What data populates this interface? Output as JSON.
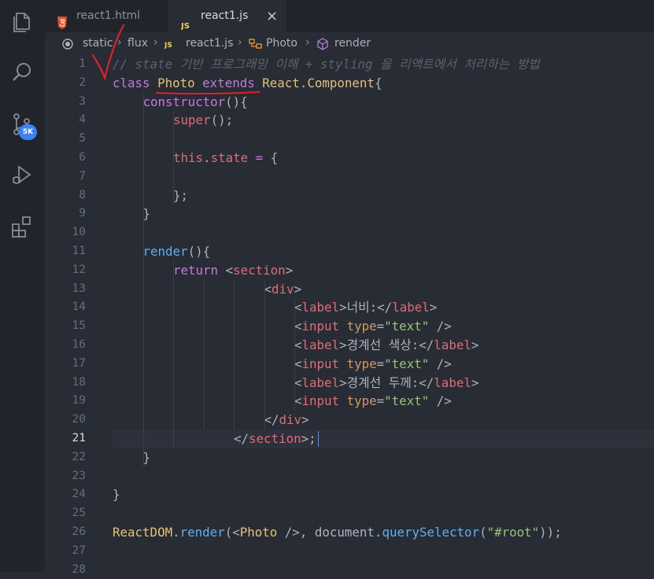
{
  "tabs": [
    {
      "label": "react1.html",
      "icon": "html5-icon",
      "active": false
    },
    {
      "label": "react1.js",
      "icon": "js-icon",
      "active": true
    }
  ],
  "tab_close": "×",
  "breadcrumb": [
    "static",
    "flux",
    "react1.js",
    "Photo",
    "render"
  ],
  "scm_badge": "5K",
  "colors": {
    "accent": "#3b82f6",
    "annotation": "#e0202a",
    "editor_bg": "#282c34"
  },
  "editor": {
    "active_line": 21,
    "line_numbers": [
      "1",
      "2",
      "3",
      "4",
      "5",
      "6",
      "7",
      "8",
      "9",
      "10",
      "11",
      "12",
      "13",
      "14",
      "15",
      "16",
      "17",
      "18",
      "19",
      "20",
      "21",
      "22",
      "23",
      "24",
      "25",
      "26",
      "27",
      "28"
    ],
    "lines": [
      {
        "n": 1,
        "indent": 0,
        "tokens": [
          {
            "t": "cmt",
            "v": "// state 기반 프로그래밍 이해 + styling 을 리액트에서 처리하는 방법"
          }
        ]
      },
      {
        "n": 2,
        "indent": 0,
        "tokens": [
          {
            "t": "kw",
            "v": "class"
          },
          {
            "t": "pun",
            "v": " "
          },
          {
            "t": "cls",
            "v": "Photo"
          },
          {
            "t": "pun",
            "v": " "
          },
          {
            "t": "kw",
            "v": "extends"
          },
          {
            "t": "pun",
            "v": " "
          },
          {
            "t": "cls",
            "v": "React"
          },
          {
            "t": "pun",
            "v": "."
          },
          {
            "t": "cls",
            "v": "Component"
          },
          {
            "t": "pun",
            "v": "{"
          }
        ]
      },
      {
        "n": 3,
        "indent": 1,
        "tokens": [
          {
            "t": "kw",
            "v": "constructor"
          },
          {
            "t": "pun",
            "v": "(){"
          }
        ]
      },
      {
        "n": 4,
        "indent": 2,
        "tokens": [
          {
            "t": "tag",
            "v": "super"
          },
          {
            "t": "pun",
            "v": "();"
          }
        ]
      },
      {
        "n": 5,
        "indent": 0,
        "tokens": []
      },
      {
        "n": 6,
        "indent": 2,
        "tokens": [
          {
            "t": "tag",
            "v": "this"
          },
          {
            "t": "pun",
            "v": "."
          },
          {
            "t": "tag",
            "v": "state"
          },
          {
            "t": "pun",
            "v": " "
          },
          {
            "t": "kw",
            "v": "="
          },
          {
            "t": "pun",
            "v": " {"
          }
        ]
      },
      {
        "n": 7,
        "indent": 0,
        "tokens": []
      },
      {
        "n": 8,
        "indent": 2,
        "tokens": [
          {
            "t": "pun",
            "v": "};"
          }
        ]
      },
      {
        "n": 9,
        "indent": 1,
        "tokens": [
          {
            "t": "pun",
            "v": "}"
          }
        ]
      },
      {
        "n": 10,
        "indent": 0,
        "tokens": []
      },
      {
        "n": 11,
        "indent": 1,
        "tokens": [
          {
            "t": "fn",
            "v": "render"
          },
          {
            "t": "pun",
            "v": "(){"
          }
        ]
      },
      {
        "n": 12,
        "indent": 2,
        "tokens": [
          {
            "t": "kw",
            "v": "return"
          },
          {
            "t": "pun",
            "v": " <"
          },
          {
            "t": "tag",
            "v": "section"
          },
          {
            "t": "pun",
            "v": ">"
          }
        ]
      },
      {
        "n": 13,
        "indent": 5,
        "tokens": [
          {
            "t": "pun",
            "v": "<"
          },
          {
            "t": "tag",
            "v": "div"
          },
          {
            "t": "pun",
            "v": ">"
          }
        ]
      },
      {
        "n": 14,
        "indent": 6,
        "tokens": [
          {
            "t": "pun",
            "v": "<"
          },
          {
            "t": "tag",
            "v": "label"
          },
          {
            "t": "pun",
            "v": ">너비:</"
          },
          {
            "t": "tag",
            "v": "label"
          },
          {
            "t": "pun",
            "v": ">"
          }
        ]
      },
      {
        "n": 15,
        "indent": 6,
        "tokens": [
          {
            "t": "pun",
            "v": "<"
          },
          {
            "t": "tag",
            "v": "input"
          },
          {
            "t": "pun",
            "v": " "
          },
          {
            "t": "attr",
            "v": "type"
          },
          {
            "t": "pun",
            "v": "="
          },
          {
            "t": "str",
            "v": "\"text\""
          },
          {
            "t": "pun",
            "v": " />"
          }
        ]
      },
      {
        "n": 16,
        "indent": 6,
        "tokens": [
          {
            "t": "pun",
            "v": "<"
          },
          {
            "t": "tag",
            "v": "label"
          },
          {
            "t": "pun",
            "v": ">경계선 색상:</"
          },
          {
            "t": "tag",
            "v": "label"
          },
          {
            "t": "pun",
            "v": ">"
          }
        ]
      },
      {
        "n": 17,
        "indent": 6,
        "tokens": [
          {
            "t": "pun",
            "v": "<"
          },
          {
            "t": "tag",
            "v": "input"
          },
          {
            "t": "pun",
            "v": " "
          },
          {
            "t": "attr",
            "v": "type"
          },
          {
            "t": "pun",
            "v": "="
          },
          {
            "t": "str",
            "v": "\"text\""
          },
          {
            "t": "pun",
            "v": " />"
          }
        ]
      },
      {
        "n": 18,
        "indent": 6,
        "tokens": [
          {
            "t": "pun",
            "v": "<"
          },
          {
            "t": "tag",
            "v": "label"
          },
          {
            "t": "pun",
            "v": ">경계선 두께:</"
          },
          {
            "t": "tag",
            "v": "label"
          },
          {
            "t": "pun",
            "v": ">"
          }
        ]
      },
      {
        "n": 19,
        "indent": 6,
        "tokens": [
          {
            "t": "pun",
            "v": "<"
          },
          {
            "t": "tag",
            "v": "input"
          },
          {
            "t": "pun",
            "v": " "
          },
          {
            "t": "attr",
            "v": "type"
          },
          {
            "t": "pun",
            "v": "="
          },
          {
            "t": "str",
            "v": "\"text\""
          },
          {
            "t": "pun",
            "v": " />"
          }
        ]
      },
      {
        "n": 20,
        "indent": 5,
        "tokens": [
          {
            "t": "pun",
            "v": "</"
          },
          {
            "t": "tag",
            "v": "div"
          },
          {
            "t": "pun",
            "v": ">"
          }
        ]
      },
      {
        "n": 21,
        "indent": 4,
        "tokens": [
          {
            "t": "pun",
            "v": "</"
          },
          {
            "t": "tag",
            "v": "section"
          },
          {
            "t": "pun",
            "v": ">;"
          }
        ]
      },
      {
        "n": 22,
        "indent": 1,
        "tokens": [
          {
            "t": "pun",
            "v": "}"
          }
        ]
      },
      {
        "n": 23,
        "indent": 0,
        "tokens": []
      },
      {
        "n": 24,
        "indent": 0,
        "tokens": [
          {
            "t": "pun",
            "v": "}"
          }
        ]
      },
      {
        "n": 25,
        "indent": 0,
        "tokens": []
      },
      {
        "n": 26,
        "indent": 0,
        "tokens": [
          {
            "t": "cls",
            "v": "ReactDOM"
          },
          {
            "t": "pun",
            "v": "."
          },
          {
            "t": "fn",
            "v": "render"
          },
          {
            "t": "pun",
            "v": "(<"
          },
          {
            "t": "cls",
            "v": "Photo"
          },
          {
            "t": "pun",
            "v": " />, document."
          },
          {
            "t": "fn",
            "v": "querySelector"
          },
          {
            "t": "pun",
            "v": "("
          },
          {
            "t": "str",
            "v": "\"#root\""
          },
          {
            "t": "pun",
            "v": "));"
          }
        ]
      },
      {
        "n": 27,
        "indent": 0,
        "tokens": []
      },
      {
        "n": 28,
        "indent": 0,
        "tokens": []
      }
    ]
  }
}
